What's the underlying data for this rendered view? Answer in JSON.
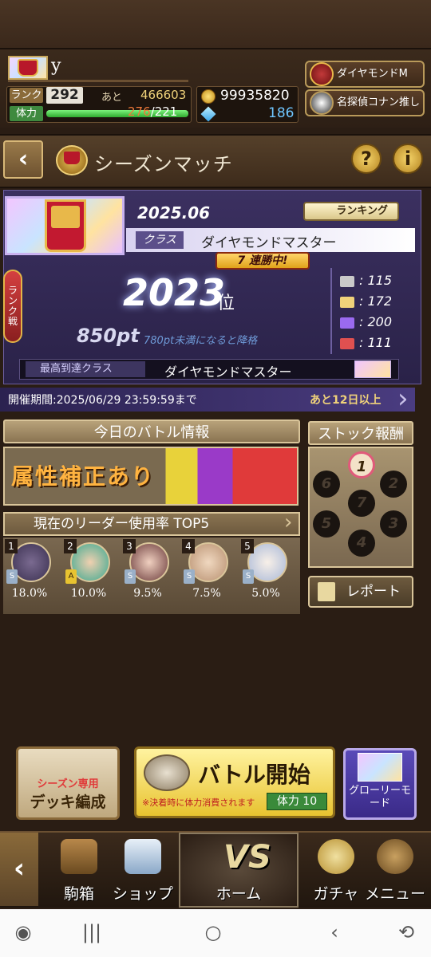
{
  "profile": {
    "name": "y",
    "rank_label": "ランク",
    "rank_value": "292",
    "ato_label": "あと",
    "ato_value": "466603",
    "hp_label": "体力",
    "hp_current": "276",
    "hp_max": "/221",
    "hp_fill_fraction": 1.0,
    "coins": "99935820",
    "gems": "186"
  },
  "badges": {
    "diamond": "ダイヤモンドM",
    "conan": "名探偵コナン推し"
  },
  "header": {
    "title": "シーズンマッチ",
    "help": "?",
    "info": "i"
  },
  "season": {
    "date": "2025.06",
    "ranking_button": "ランキング",
    "class_label": "クラス",
    "class_value": "ダイヤモンドマスター",
    "streak": "7 連勝中!",
    "side_tab": "ランク戦",
    "rank": "2023",
    "rank_unit": "位",
    "points": "850pt",
    "points_note": "780pt未満になると降格",
    "stats": [
      {
        "value": "115",
        "color": "#c9c9c9"
      },
      {
        "value": "172",
        "color": "#f0d27a"
      },
      {
        "value": "200",
        "color": "#9a6af0"
      },
      {
        "value": "111",
        "color": "#e05050"
      }
    ],
    "best_label": "最高到達クラス",
    "best_value": "ダイヤモンドマスター",
    "period": "開催期間:2025/06/29 23:59:59まで",
    "period_left": "あと12日以上"
  },
  "battle_info": {
    "title": "今日のバトル情報",
    "attribute_banner": "属性補正あり",
    "leader_title": "現在のリーダー使用率 TOP5",
    "leaders": [
      {
        "rank": "1",
        "pct": "18.0%",
        "tag": "S",
        "color": "#3a3050"
      },
      {
        "rank": "2",
        "pct": "10.0%",
        "tag": "A",
        "color": "#3aa890"
      },
      {
        "rank": "3",
        "pct": "9.5%",
        "tag": "S",
        "color": "#6a3a3a"
      },
      {
        "rank": "4",
        "pct": "7.5%",
        "tag": "S",
        "color": "#b89070"
      },
      {
        "rank": "5",
        "pct": "5.0%",
        "tag": "S",
        "color": "#a8b8d8"
      }
    ]
  },
  "stock": {
    "title": "ストック報酬",
    "nodes": [
      "1",
      "2",
      "3",
      "4",
      "5",
      "6",
      "7"
    ],
    "report_button": "レポート"
  },
  "actions": {
    "deck_small": "シーズン専用",
    "deck_big": "デッキ編成",
    "battle_title": "バトル開始",
    "battle_note": "※決着時に体力消費されます",
    "battle_cost": "体力 10",
    "glory": "グローリーモード"
  },
  "nav": {
    "back": "‹",
    "items": [
      "駒箱",
      "ショップ",
      "ホーム",
      "ガチャ",
      "メニュー"
    ],
    "vs": "VS"
  }
}
